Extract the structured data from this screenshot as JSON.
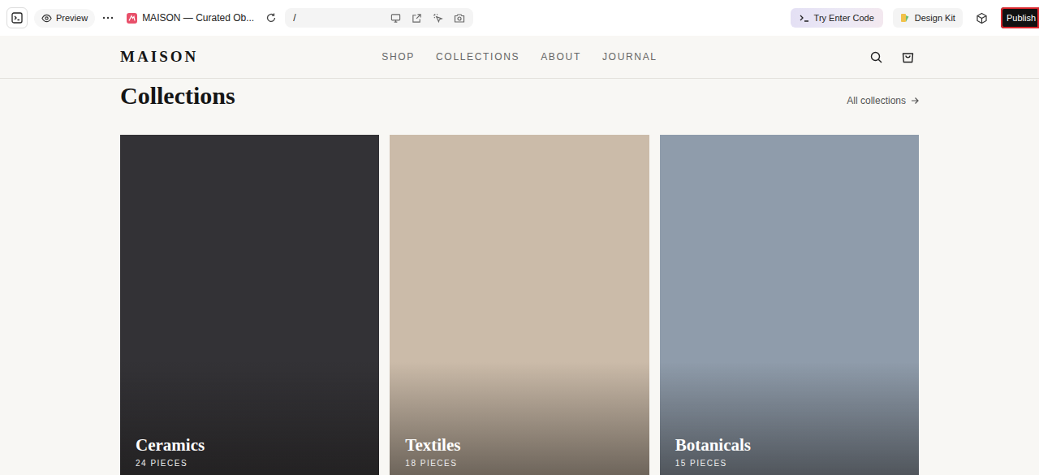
{
  "toolbar": {
    "preview": "Preview",
    "tab_title": "MAISON — Curated Ob...",
    "url": "/",
    "try_code": "Try Enter Code",
    "design_kit": "Design Kit",
    "publish": "Publish"
  },
  "site": {
    "logo": "MAISON",
    "nav": [
      {
        "label": "SHOP"
      },
      {
        "label": "COLLECTIONS"
      },
      {
        "label": "ABOUT"
      },
      {
        "label": "JOURNAL"
      }
    ]
  },
  "section": {
    "title": "Collections",
    "link": "All collections"
  },
  "collections": [
    {
      "name": "Ceramics",
      "count": "24 PIECES",
      "color": "#333236"
    },
    {
      "name": "Textiles",
      "count": "18 PIECES",
      "color": "#cbbba9"
    },
    {
      "name": "Botanicals",
      "count": "15 PIECES",
      "color": "#8f9cab"
    }
  ]
}
